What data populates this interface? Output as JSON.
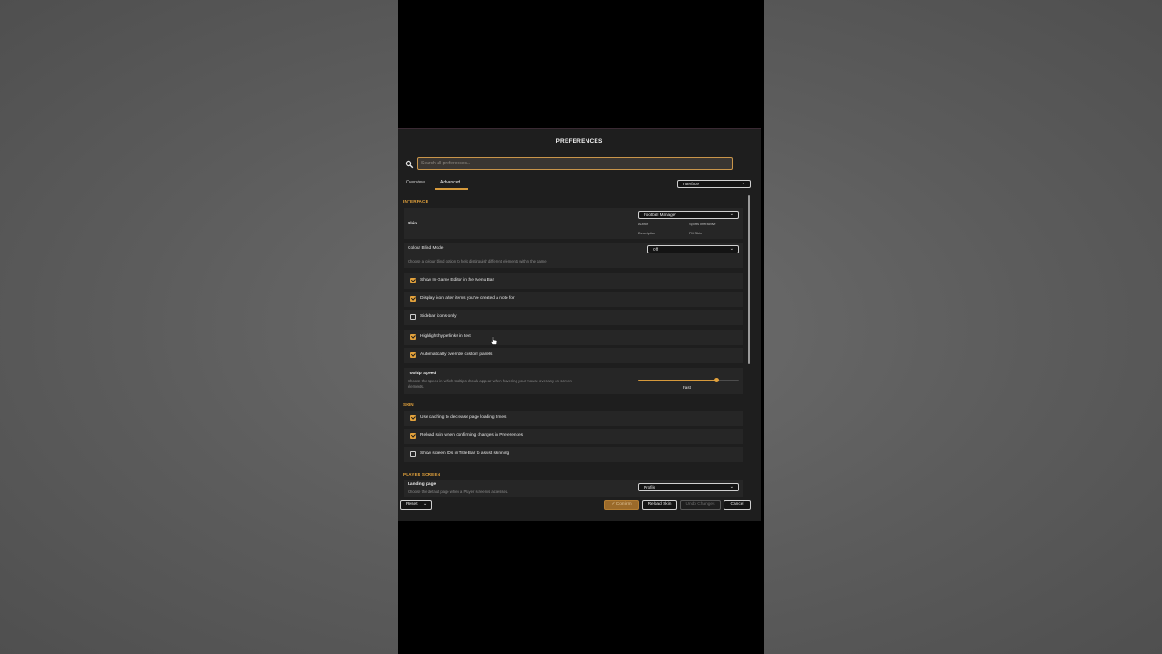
{
  "dialog": {
    "title": "PREFERENCES",
    "search": {
      "placeholder": "Search all preferences...",
      "value": ""
    },
    "tabs": [
      {
        "label": "Overview",
        "active": false
      },
      {
        "label": "Advanced",
        "active": true
      }
    ],
    "category_dropdown": "Interface"
  },
  "interface": {
    "heading": "INTERFACE",
    "skin": {
      "label": "Skin",
      "value": "Football Manager",
      "author_label": "Author",
      "author_value": "Sports Interactive",
      "description_label": "Description",
      "description_value": "FM Skin"
    },
    "colour_blind": {
      "label": "Colour Blind Mode",
      "description": "Choose a colour blind option to help distinguish different elements within the game",
      "value": "Off"
    },
    "checkboxes": [
      {
        "label": "Show In-Game Editor in the Menu Bar",
        "checked": true
      },
      {
        "label": "Display icon after items you've created a note for",
        "checked": true
      },
      {
        "label": "Sidebar icons-only",
        "checked": false
      },
      {
        "label": "Highlight hyperlinks in text",
        "checked": true
      },
      {
        "label": "Automatically override custom panels",
        "checked": true
      }
    ],
    "tooltip": {
      "label": "Tooltip Speed",
      "description_line1": "Choose the speed in which tooltips should appear when hovering your mouse over any on-screen",
      "description_line2": "elements.",
      "value_label": "Fast",
      "level": 0.78
    }
  },
  "skin_section": {
    "heading": "SKIN",
    "checkboxes": [
      {
        "label": "Use caching to decrease page loading times",
        "checked": true
      },
      {
        "label": "Reload skin when confirming changes in Preferences",
        "checked": true
      },
      {
        "label": "Show screen IDs in Title Bar to assist skinning",
        "checked": false
      }
    ]
  },
  "player_screen": {
    "heading": "PLAYER SCREEN",
    "landing": {
      "label": "Landing page",
      "description": "Choose the default page when a Player screen is accessed.",
      "value": "Profile"
    }
  },
  "footer": {
    "reset": "Reset",
    "confirm": "Confirm",
    "reload_skin": "Reload Skin",
    "undo": "Undo Changes",
    "cancel": "Cancel"
  },
  "colors": {
    "accent": "#e3a23c",
    "panel": "#1e1e1e",
    "row": "#262626"
  }
}
